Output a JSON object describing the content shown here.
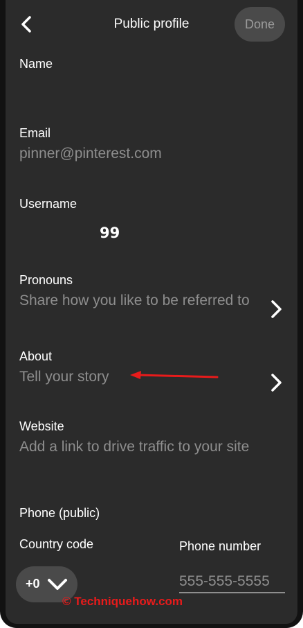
{
  "header": {
    "title": "Public profile",
    "done_label": "Done"
  },
  "fields": {
    "name": {
      "label": "Name",
      "value": ""
    },
    "email": {
      "label": "Email",
      "placeholder": "pinner@pinterest.com"
    },
    "username": {
      "label": "Username",
      "value": "99"
    },
    "pronouns": {
      "label": "Pronouns",
      "placeholder": "Share how you like to be referred to"
    },
    "about": {
      "label": "About",
      "placeholder": "Tell your story"
    },
    "website": {
      "label": "Website",
      "placeholder": "Add a link to drive traffic to your site"
    },
    "phone": {
      "section_label": "Phone (public)",
      "country_code_label": "Country code",
      "country_code_value": "+0",
      "number_label": "Phone number",
      "number_placeholder": "555-555-5555"
    }
  },
  "icons": {
    "back": "chevron-left-icon",
    "pronouns_chevron": "chevron-right-icon",
    "about_chevron": "chevron-right-icon",
    "country_dropdown": "chevron-down-icon"
  },
  "colors": {
    "background": "#2b2b2b",
    "text": "#ffffff",
    "placeholder": "#8e8e8e",
    "button_bg": "#4a4a4a",
    "annotation_red": "#e81b1b"
  },
  "watermark": "© Techniquehow.com"
}
